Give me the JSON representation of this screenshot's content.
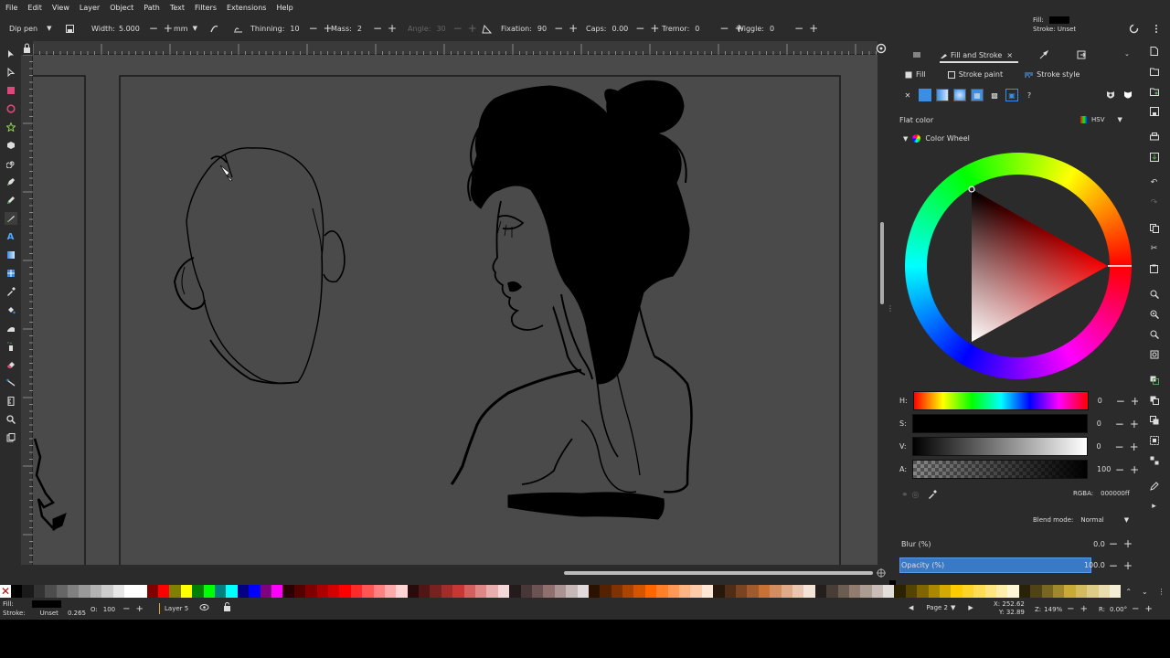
{
  "menu": [
    "File",
    "Edit",
    "View",
    "Layer",
    "Object",
    "Path",
    "Text",
    "Filters",
    "Extensions",
    "Help"
  ],
  "toolbar": {
    "preset": "Dip pen",
    "width_label": "Width:",
    "width_value": "5.000",
    "unit": "mm",
    "thinning_label": "Thinning:",
    "thinning_value": "10",
    "mass_label": "Mass:",
    "mass_value": "2",
    "angle_label": "Angle:",
    "angle_value": "30",
    "fixation_label": "Fixation:",
    "fixation_value": "90",
    "caps_label": "Caps:",
    "caps_value": "0.00",
    "tremor_label": "Tremor:",
    "tremor_value": "0",
    "wiggle_label": "Wiggle:",
    "wiggle_value": "0"
  },
  "style_indicator": {
    "fill_label": "Fill:",
    "stroke_label": "Stroke:",
    "stroke_value": "Unset",
    "fill_color": "#000000"
  },
  "panel": {
    "tab_title": "Fill and Stroke",
    "subtabs": {
      "fill": "Fill",
      "stroke_paint": "Stroke paint",
      "stroke_style": "Stroke style"
    },
    "flat_color": "Flat color",
    "mode": "HSV",
    "color_wheel": "Color Wheel",
    "sliders": [
      {
        "label": "H:",
        "value": "0"
      },
      {
        "label": "S:",
        "value": "0"
      },
      {
        "label": "V:",
        "value": "0"
      },
      {
        "label": "A:",
        "value": "100"
      }
    ],
    "rgba_label": "RGBA:",
    "rgba_value": "000000ff",
    "blend_label": "Blend mode:",
    "blend_value": "Normal",
    "blur_label": "Blur (%)",
    "blur_value": "0.0",
    "opacity_label": "Opacity (%)",
    "opacity_value": "100.0"
  },
  "status": {
    "fill_label": "Fill:",
    "stroke_label": "Stroke:",
    "stroke_value": "Unset",
    "stroke_width": "0.265",
    "opacity_label": "O:",
    "opacity_value": "100",
    "layer": "Layer 5",
    "page": "Page 2",
    "x_label": "X:",
    "x_value": "252.62",
    "y_label": "Y:",
    "y_value": "32.89",
    "zoom_label": "Z:",
    "zoom_value": "149%",
    "rotate_label": "R:",
    "rotate_value": "0.00°"
  },
  "palette": [
    "#000000",
    "#1a1a1a",
    "#333333",
    "#4d4d4d",
    "#666666",
    "#808080",
    "#999999",
    "#b3b3b3",
    "#cccccc",
    "#e6e6e6",
    "#ffffff",
    "#ffffff",
    "#800000",
    "#ff0000",
    "#808000",
    "#ffff00",
    "#008000",
    "#00ff00",
    "#008080",
    "#00ffff",
    "#000080",
    "#0000ff",
    "#800080",
    "#ff00ff",
    "#2b0000",
    "#550000",
    "#800000",
    "#aa0000",
    "#d40000",
    "#ff0000",
    "#ff2a2a",
    "#ff5555",
    "#ff8080",
    "#ffaaaa",
    "#ffd5d5",
    "#280b0b",
    "#501616",
    "#782121",
    "#a02c2c",
    "#c83737",
    "#d35f5f",
    "#de8787",
    "#e9afaf",
    "#f4d7d7",
    "#241c1c",
    "#483737",
    "#6c5353",
    "#916f6f",
    "#ac9393",
    "#c8b7b7",
    "#e3dbdb",
    "#2b1100",
    "#552200",
    "#803300",
    "#aa4400",
    "#d45500",
    "#ff6600",
    "#ff7f2a",
    "#ff9955",
    "#ffb380",
    "#ffccaa",
    "#ffe6d5",
    "#28170b",
    "#502d16",
    "#784421",
    "#a05a2c",
    "#c87137",
    "#d38d5f",
    "#deaa87",
    "#e9c6af",
    "#f4e3d7",
    "#241f1c",
    "#483e37",
    "#6c5d53",
    "#917c6f",
    "#ac9d93",
    "#c8beb7",
    "#e3dedb",
    "#2b2200",
    "#554400",
    "#806600",
    "#aa8800",
    "#d4aa00",
    "#ffcc00",
    "#ffd42a",
    "#ffdd55",
    "#ffe680",
    "#ffeeaa",
    "#fff6d5",
    "#28220b",
    "#504416",
    "#786721",
    "#a0892c",
    "#c8ab37",
    "#d3bc5f",
    "#decd87",
    "#e9ddaf",
    "#f4eed7"
  ]
}
